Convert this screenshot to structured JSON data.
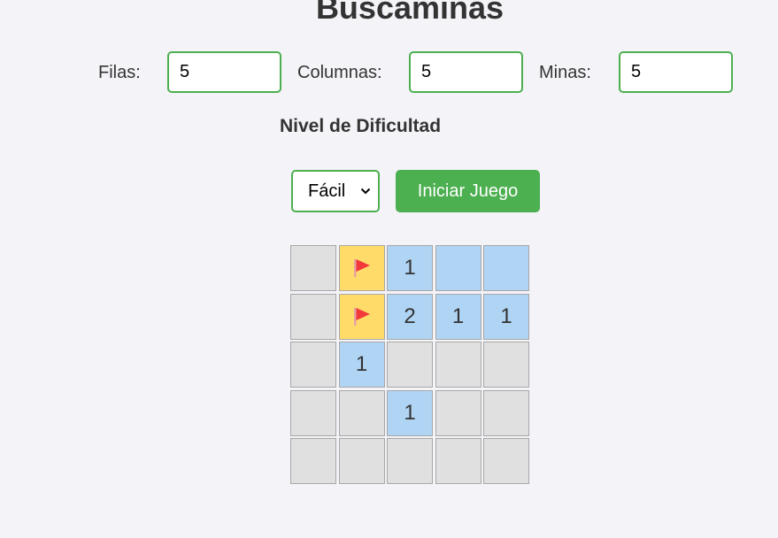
{
  "title": "Buscaminas",
  "config": {
    "rows": {
      "label": "Filas:",
      "value": "5"
    },
    "cols": {
      "label": "Columnas:",
      "value": "5"
    },
    "mines": {
      "label": "Minas:",
      "value": "5"
    }
  },
  "difficulty": {
    "heading": "Nivel de Dificultad",
    "selected": "Fácil"
  },
  "start_button": "Iniciar Juego",
  "colors": {
    "accent": "#4caf50",
    "revealed": "#b0d4f4",
    "flagged": "#ffdc6a",
    "hidden": "#e0e0e0",
    "flag_red": "#f23a3a"
  },
  "board": [
    [
      {
        "s": "hidden",
        "v": ""
      },
      {
        "s": "flagged",
        "v": ""
      },
      {
        "s": "revealed",
        "v": "1"
      },
      {
        "s": "revealed",
        "v": ""
      },
      {
        "s": "revealed",
        "v": ""
      }
    ],
    [
      {
        "s": "hidden",
        "v": ""
      },
      {
        "s": "flagged",
        "v": ""
      },
      {
        "s": "revealed",
        "v": "2"
      },
      {
        "s": "revealed",
        "v": "1"
      },
      {
        "s": "revealed",
        "v": "1"
      }
    ],
    [
      {
        "s": "hidden",
        "v": ""
      },
      {
        "s": "revealed",
        "v": "1"
      },
      {
        "s": "hidden",
        "v": ""
      },
      {
        "s": "hidden",
        "v": ""
      },
      {
        "s": "hidden",
        "v": ""
      }
    ],
    [
      {
        "s": "hidden",
        "v": ""
      },
      {
        "s": "hidden",
        "v": ""
      },
      {
        "s": "revealed",
        "v": "1"
      },
      {
        "s": "hidden",
        "v": ""
      },
      {
        "s": "hidden",
        "v": ""
      }
    ],
    [
      {
        "s": "hidden",
        "v": ""
      },
      {
        "s": "hidden",
        "v": ""
      },
      {
        "s": "hidden",
        "v": ""
      },
      {
        "s": "hidden",
        "v": ""
      },
      {
        "s": "hidden",
        "v": ""
      }
    ]
  ]
}
